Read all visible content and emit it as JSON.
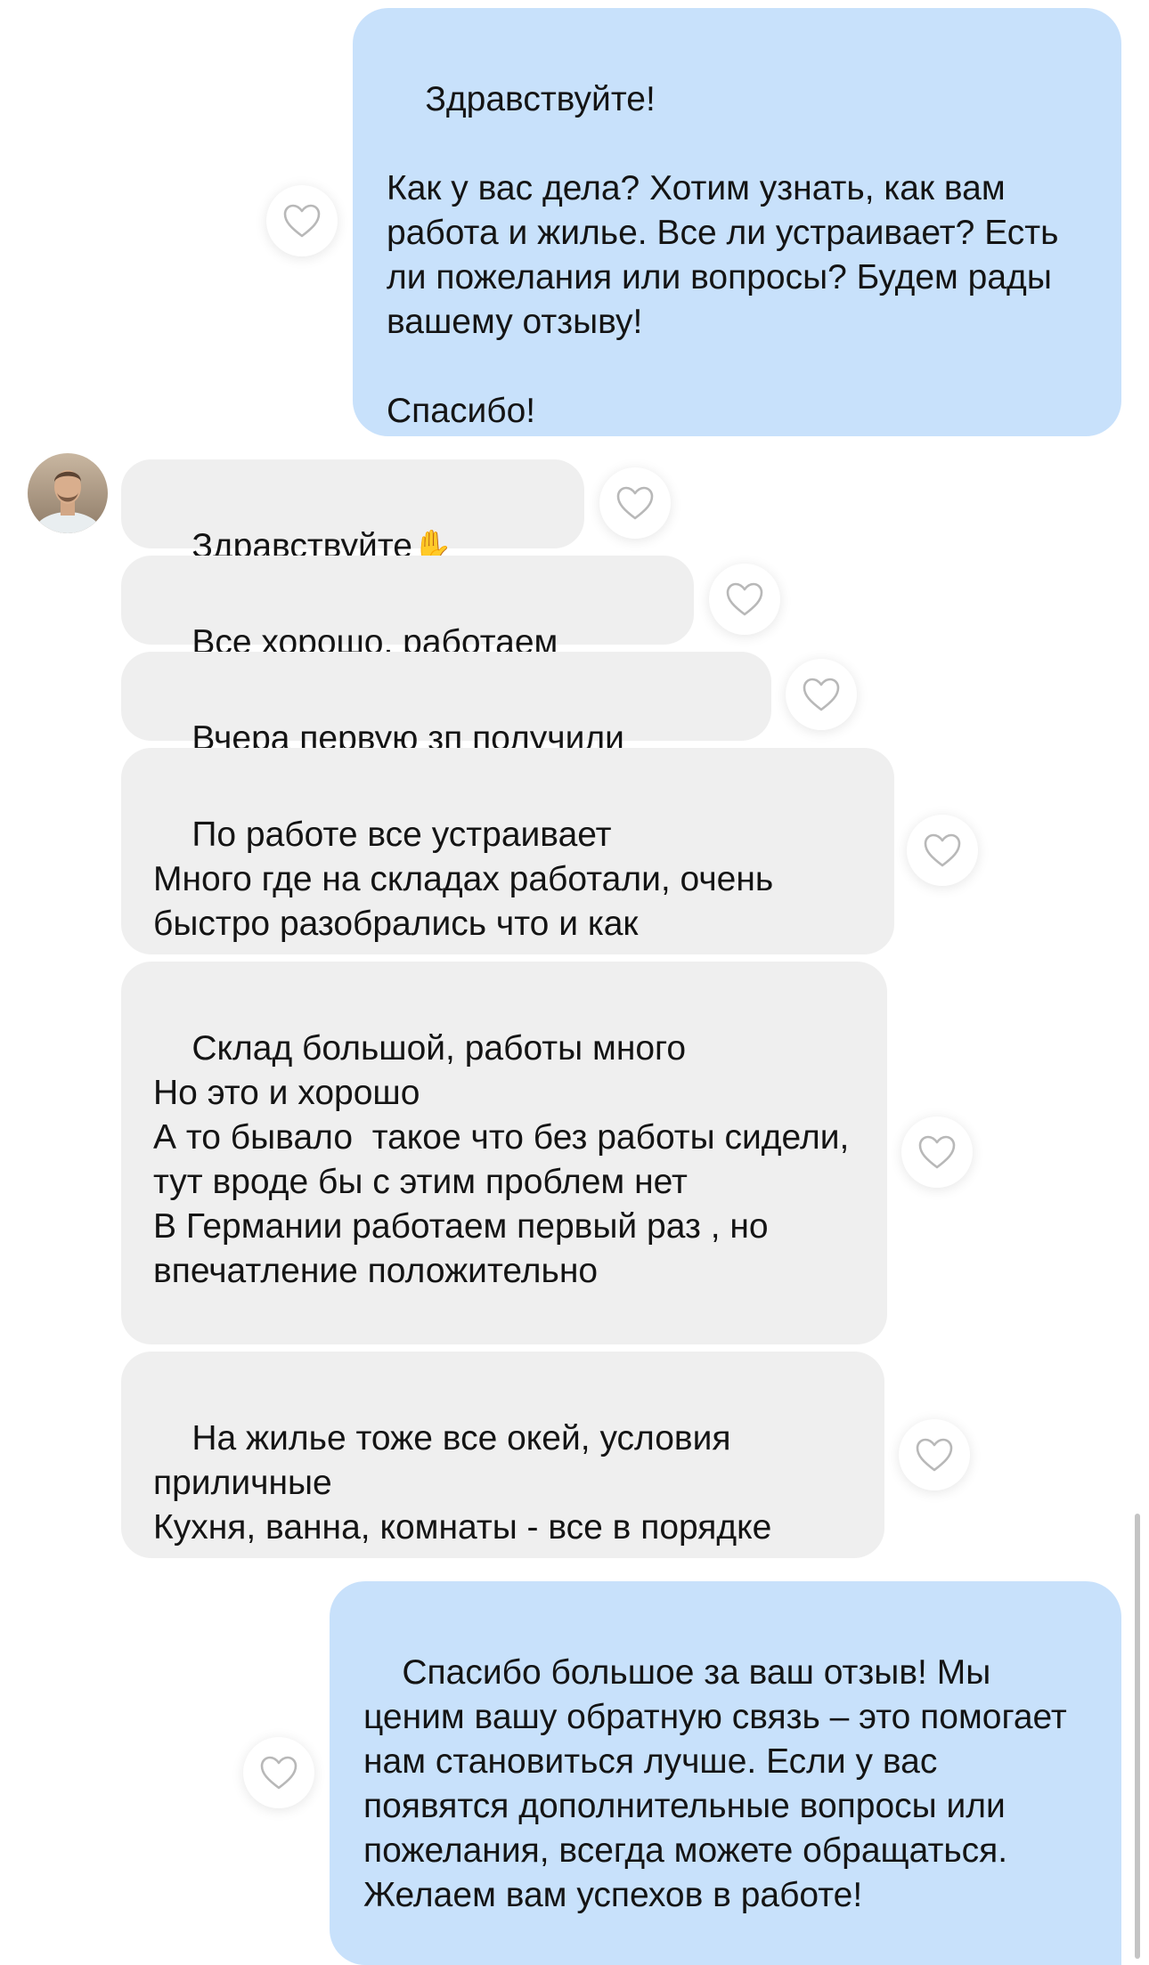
{
  "colors": {
    "outgoing_bubble": "#c8e1fb",
    "incoming_bubble": "#efefef",
    "text": "#141414",
    "heart_outline": "#b8b8b8"
  },
  "messages": [
    {
      "direction": "outgoing",
      "text": "Здравствуйте!\n\nКак у вас дела? Хотим узнать, как вам работа и жилье. Все ли устраивает? Есть ли пожелания или вопросы? Будем рады вашему отзыву!\n\nСпасибо!"
    },
    {
      "direction": "incoming",
      "text": "Здравствуйте",
      "emoji": "✋"
    },
    {
      "direction": "incoming",
      "text": "Все хорошо, работаем"
    },
    {
      "direction": "incoming",
      "text": "Вчера первую зп получили"
    },
    {
      "direction": "incoming",
      "text": "По работе все устраивает\nМного где на складах работали, очень быстро разобрались что и как"
    },
    {
      "direction": "incoming",
      "text": "Склад большой, работы много\nНо это и хорошо\nА то бывало  такое что без работы сидели, тут вроде бы с этим проблем нет\nВ Германии работаем первый раз , но впечатление положительно"
    },
    {
      "direction": "incoming",
      "text": "На жилье тоже все окей, условия приличные\nКухня, ванна, комнаты - все в порядке"
    },
    {
      "direction": "outgoing",
      "text": "Спасибо большое за ваш отзыв! Мы ценим вашу обратную связь – это помогает нам становиться лучше. Если у вас появятся дополнительные вопросы или пожелания, всегда можете обращаться. Желаем вам успехов в работе!"
    }
  ],
  "icons": {
    "like": "heart-outline-icon",
    "avatar": "contact-avatar"
  }
}
